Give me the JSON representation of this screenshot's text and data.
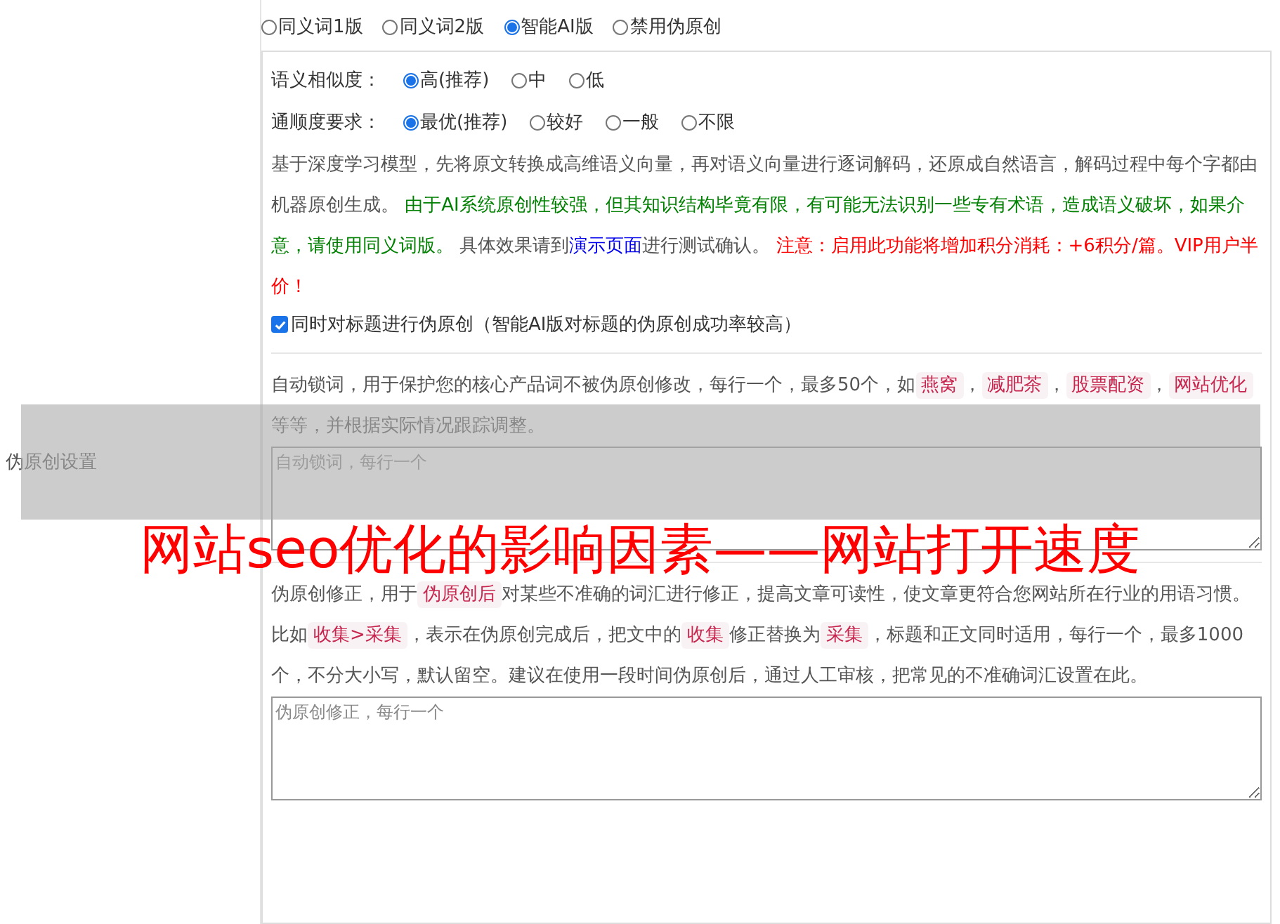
{
  "side_label": "伪原创设置",
  "modes": [
    {
      "label": "同义词1版",
      "selected": false
    },
    {
      "label": "同义词2版",
      "selected": false
    },
    {
      "label": "智能AI版",
      "selected": true
    },
    {
      "label": "禁用伪原创",
      "selected": false
    }
  ],
  "similarity": {
    "label": "语义相似度：",
    "options": [
      {
        "label": "高(推荐)",
        "selected": true
      },
      {
        "label": "中",
        "selected": false
      },
      {
        "label": "低",
        "selected": false
      }
    ]
  },
  "fluency": {
    "label": "通顺度要求：",
    "options": [
      {
        "label": "最优(推荐)",
        "selected": true
      },
      {
        "label": "较好",
        "selected": false
      },
      {
        "label": "一般",
        "selected": false
      },
      {
        "label": "不限",
        "selected": false
      }
    ]
  },
  "description": [
    {
      "kind": "plain",
      "text": "基于深度学习模型，先将原文转换成高维语义向量，再对语义向量进行逐词解码，还原成自然语言，解码过程中每个字都由机器原创生成。 "
    },
    {
      "kind": "green",
      "text": "由于AI系统原创性较强，但其知识结构毕竟有限，有可能无法识别一些专有术语，造成语义破坏，如果介意，请使用同义词版。"
    },
    {
      "kind": "plain",
      "text": " 具体效果请到"
    },
    {
      "kind": "link",
      "text": "演示页面"
    },
    {
      "kind": "plain",
      "text": "进行测试确认。 "
    },
    {
      "kind": "red",
      "text": "注意：启用此功能将增加积分消耗：+6积分/篇。VIP用户半价！"
    }
  ],
  "title_option": {
    "label": "同时对标题进行伪原创（智能AI版对标题的伪原创成功率较高）",
    "checked": true
  },
  "lock_words": {
    "description": [
      {
        "kind": "plain",
        "text": "自动锁词，用于保护您的核心产品词不被伪原创修改，每行一个，最多50个，如"
      },
      {
        "kind": "code",
        "text": "燕窝"
      },
      {
        "kind": "plain",
        "text": "，"
      },
      {
        "kind": "code",
        "text": "减肥茶"
      },
      {
        "kind": "plain",
        "text": "，"
      },
      {
        "kind": "code",
        "text": "股票配资"
      },
      {
        "kind": "plain",
        "text": "，"
      },
      {
        "kind": "code",
        "text": "网站优化"
      },
      {
        "kind": "plain",
        "text": " 等等，并根据实际情况跟踪调整。"
      }
    ],
    "placeholder": "自动锁词，每行一个"
  },
  "corrections": {
    "description": [
      {
        "kind": "plain",
        "text": "伪原创修正，用于"
      },
      {
        "kind": "code",
        "text": "伪原创后"
      },
      {
        "kind": "plain",
        "text": "对某些不准确的词汇进行修正，提高文章可读性，使文章更符合您网站所在行业的用语习惯。比如"
      },
      {
        "kind": "code",
        "text": "收集>采集"
      },
      {
        "kind": "plain",
        "text": "，表示在伪原创完成后，把文中的"
      },
      {
        "kind": "code",
        "text": "收集"
      },
      {
        "kind": "plain",
        "text": "修正替换为"
      },
      {
        "kind": "code",
        "text": "采集"
      },
      {
        "kind": "plain",
        "text": "，标题和正文同时适用，每行一个，最多1000个，不分大小写，默认留空。建议在使用一段时间伪原创后，通过人工审核，把常见的不准确词汇设置在此。"
      }
    ],
    "placeholder": "伪原创修正，每行一个"
  },
  "overlay": {
    "title": "网站seo优化的影响因素——网站打开速度"
  }
}
